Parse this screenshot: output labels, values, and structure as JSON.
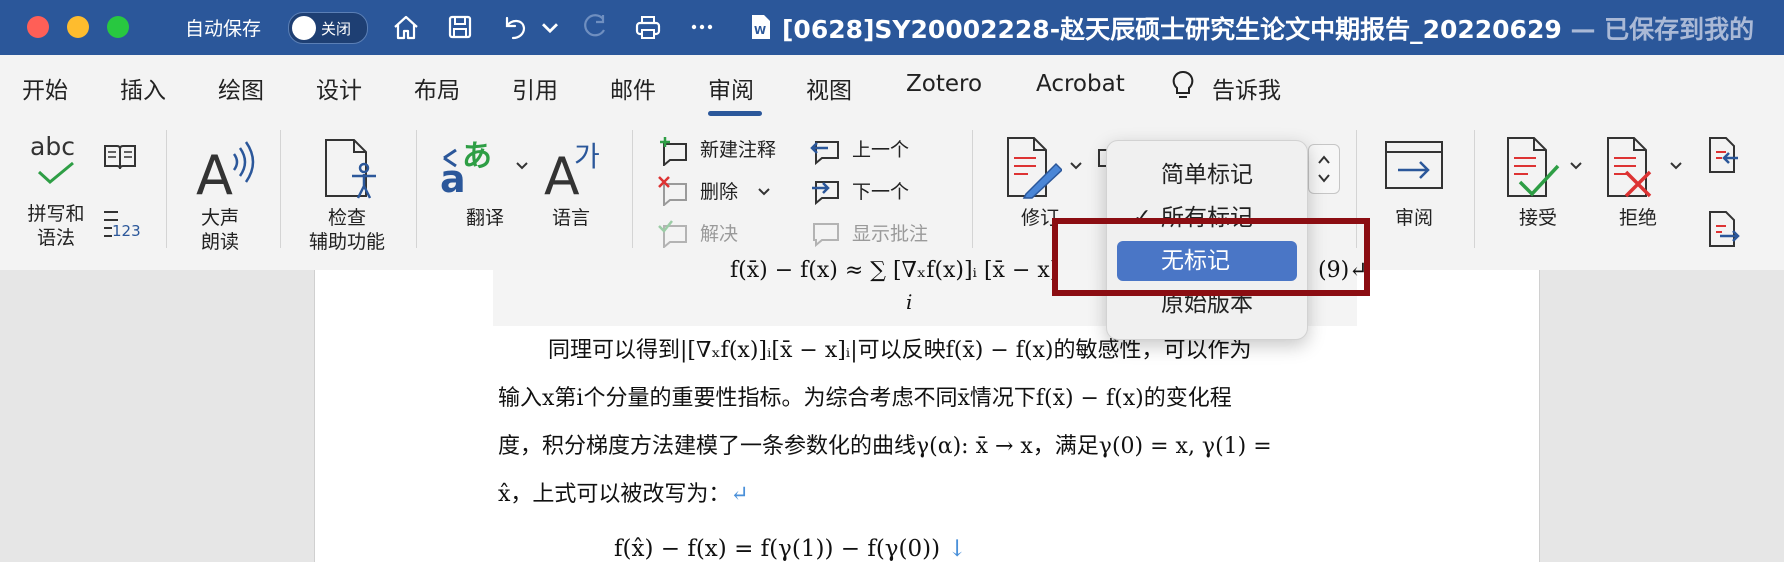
{
  "titlebar": {
    "autosave_label": "自动保存",
    "toggle_state": "关闭",
    "doc_title": "[0628]SY20002228-赵天辰硕士研究生论文中期报告_20220629",
    "saved_status": " — 已保存到我的"
  },
  "tabs": [
    {
      "label": "开始"
    },
    {
      "label": "插入"
    },
    {
      "label": "绘图"
    },
    {
      "label": "设计"
    },
    {
      "label": "布局"
    },
    {
      "label": "引用"
    },
    {
      "label": "邮件"
    },
    {
      "label": "审阅"
    },
    {
      "label": "视图"
    },
    {
      "label": "Zotero"
    },
    {
      "label": "Acrobat"
    },
    {
      "label": "告诉我"
    }
  ],
  "active_tab": "审阅",
  "ribbon": {
    "spelling_line1": "拼写和",
    "spelling_line2": "语法",
    "spelling_icon_text": "abc",
    "count_icon_text": "123",
    "read_aloud_line1": "大声",
    "read_aloud_line2": "朗读",
    "accessibility_line1": "检查",
    "accessibility_line2": "辅助功能",
    "translate": "翻译",
    "language": "语言",
    "new_comment": "新建注释",
    "delete": "删除",
    "resolve": "解决",
    "previous": "上一个",
    "next": "下一个",
    "show_comments": "显示批注",
    "track_changes": "修订",
    "reviewing_pane": "审阅",
    "accept": "接受",
    "reject": "拒绝"
  },
  "markup_menu": {
    "items": [
      {
        "label": "简单标记",
        "checked": false,
        "selected": false
      },
      {
        "label": "所有标记",
        "checked": true,
        "selected": false
      },
      {
        "label": "无标记",
        "checked": false,
        "selected": true
      },
      {
        "label": "原始版本",
        "checked": false,
        "selected": false
      }
    ]
  },
  "document": {
    "eq_top": "f(x̄) − f(x) ≈ ∑ [∇ₓf(x)]ᵢ [x̄ − x]",
    "eq_top_index": "i",
    "eq_number": "(9)↵",
    "para_line1": "同理可以得到|[∇ₓf(x)]ᵢ[x̄ − x]ᵢ|可以反映f(x̄) − f(x)的敏感性，可以作为",
    "para_line2": "输入x第i个分量的重要性指标。为综合考虑不同x̄情况下f(x̄) − f(x)的变化程",
    "para_line3": "度，积分梯度方法建模了一条参数化的曲线γ(α): x̄ → x，满足γ(0) = x, γ(1) =",
    "para_line4": "x̂，上式可以被改写为：",
    "para_line4_mark": "↵",
    "eq_bottom": "f(x̂) − f(x) = f(γ(1)) − f(γ(0))",
    "eq_bottom_mark": "↓"
  }
}
